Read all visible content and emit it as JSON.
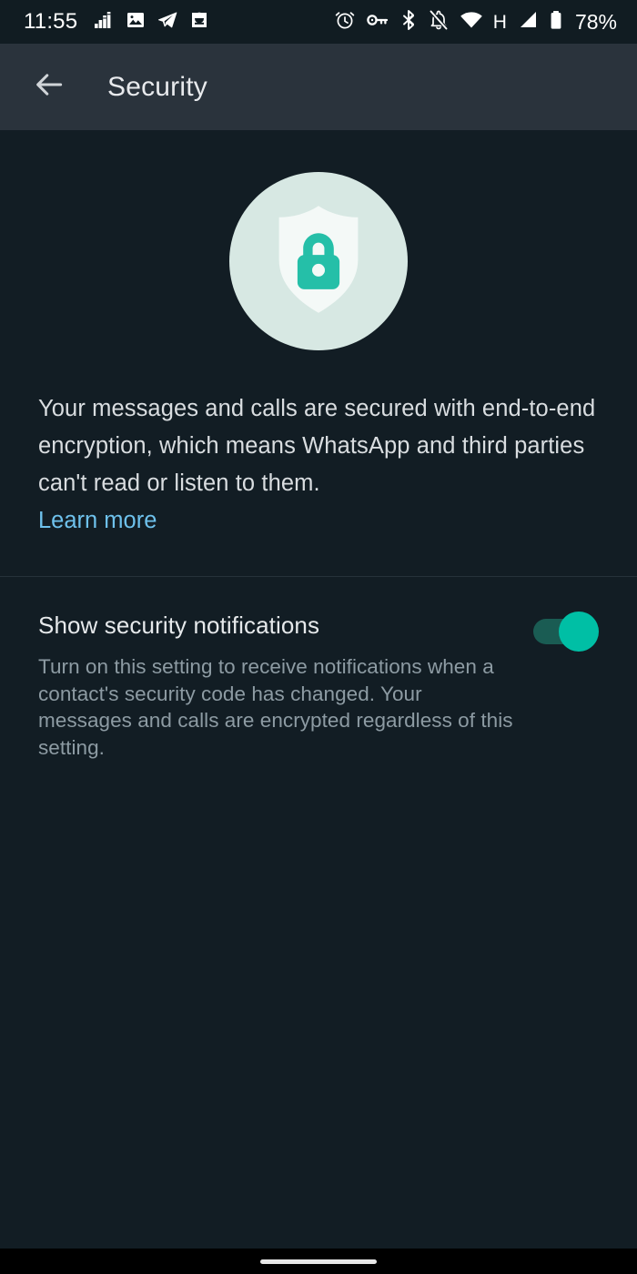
{
  "status_bar": {
    "clock": "11:55",
    "battery_percent": "78%",
    "network_type": "H",
    "left_icons": [
      {
        "name": "equalizer-icon"
      },
      {
        "name": "image-icon"
      },
      {
        "name": "telegram-send-icon"
      },
      {
        "name": "download-notification-icon"
      }
    ],
    "right_icons": [
      {
        "name": "alarm-clock-icon"
      },
      {
        "name": "vpn-key-icon"
      },
      {
        "name": "bluetooth-icon"
      },
      {
        "name": "notifications-muted-icon"
      },
      {
        "name": "wifi-icon"
      },
      {
        "name": "cellular-signal-icon"
      },
      {
        "name": "battery-icon"
      }
    ]
  },
  "app_bar": {
    "title": "Security",
    "back_icon": "arrow-back-icon"
  },
  "hero": {
    "circle_color": "#d7e8e3",
    "shield_color": "#f4f9f7",
    "lock_color": "#25bfa8",
    "shield_icon": "shield-icon",
    "lock_icon": "lock-icon"
  },
  "encryption": {
    "body": "Your messages and calls are secured with end-to-end encryption, which means WhatsApp and third parties can't read or listen to them.",
    "learn_more_label": "Learn more",
    "link_color": "#6ec1ec"
  },
  "settings": {
    "notifications": {
      "title": "Show security notifications",
      "description": "Turn on this setting to receive notifications when a contact's security code has changed. Your messages and calls are encrypted regardless of this setting.",
      "toggle_state": "on",
      "toggle_track_color": "#1a5c53",
      "toggle_thumb_color": "#00bfa5"
    }
  },
  "nav_bar": {
    "gesture_pill": "home-gesture-pill"
  }
}
